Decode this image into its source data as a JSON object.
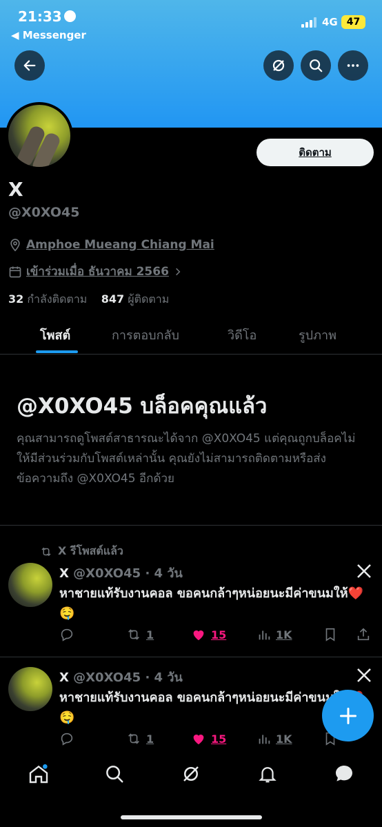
{
  "status_bar": {
    "time": "21:33",
    "back_app": "◀ Messenger",
    "network": "4G",
    "battery": "47"
  },
  "profile": {
    "follow_label": "ติดตาม",
    "display_name": "X",
    "handle": "@X0XO45",
    "location": "Amphoe Mueang Chiang Mai",
    "joined": "เข้าร่วมเมื่อ ธันวาคม 2566",
    "following_count": "32",
    "following_label": "กำลังติดตาม",
    "followers_count": "847",
    "followers_label": "ผู้ติดตาม"
  },
  "tabs": [
    {
      "label": "โพสต์",
      "active": true
    },
    {
      "label": "การตอบกลับ",
      "active": false
    },
    {
      "label": "วิดีโอ",
      "active": false
    },
    {
      "label": "รูปภาพ",
      "active": false
    }
  ],
  "blocked": {
    "title": "@X0XO45 บล็อคคุณแล้ว",
    "description": "คุณสามารถดูโพสต์สาธารณะได้จาก @X0XO45 แต่คุณถูกบล็อคไม่ให้มีส่วนร่วมกับโพสต์เหล่านั้น คุณยังไม่สามารถติดตามหรือส่งข้อความถึง @X0XO45 อีกด้วย"
  },
  "repost_label": "X รีโพสต์แล้ว",
  "posts": [
    {
      "name": "X",
      "handle": "@X0XO45",
      "time": "· 4 วัน",
      "text": "หาชายแท้รับงานคอล ขอคนกล้าๆหน่อยนะมีค่าขนมให้❤️ 🤤",
      "reposts": "1",
      "likes": "15",
      "views": "1K"
    },
    {
      "name": "X",
      "handle": "@X0XO45",
      "time": "· 4 วัน",
      "text": "หาชายแท้รับงานคอล ขอคนกล้าๆหน่อยนะมีค่าขนมให้❤️ 🤤",
      "reposts": "1",
      "likes": "15",
      "views": "1K"
    }
  ],
  "colors": {
    "accent": "#1d9bf0",
    "like": "#f91880",
    "banner": "#2196f3"
  }
}
